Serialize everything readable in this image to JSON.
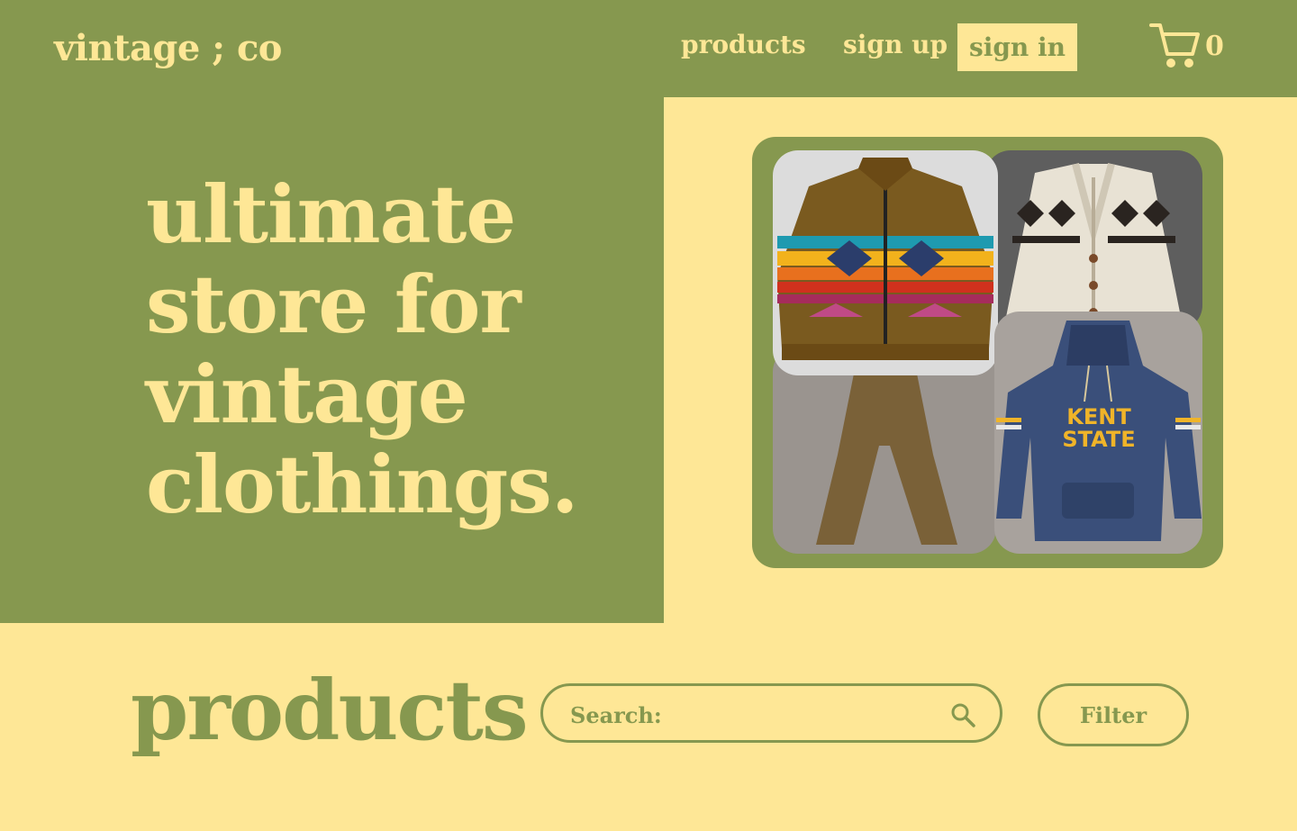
{
  "brand": {
    "logo": "vintage ; co"
  },
  "nav": {
    "products": "products",
    "sign_up": "sign up",
    "sign_in": "sign in",
    "cart_count": "0",
    "cart_icon": "shopping-cart-icon"
  },
  "hero": {
    "lines": [
      "ultimate",
      "store for",
      "vintage",
      "clothings."
    ]
  },
  "gallery": {
    "items": [
      {
        "name": "patterned-wool-jacket"
      },
      {
        "name": "knit-shawl-cardigan"
      },
      {
        "name": "corduroy-flared-pants"
      },
      {
        "name": "kent-state-hoodie",
        "printed_text": "KENT STATE"
      }
    ]
  },
  "products_section": {
    "title": "products",
    "search_label": "Search:",
    "search_value": "",
    "search_icon": "search-icon",
    "filter_label": "Filter"
  },
  "colors": {
    "green": "#86984f",
    "cream": "#fee796"
  }
}
